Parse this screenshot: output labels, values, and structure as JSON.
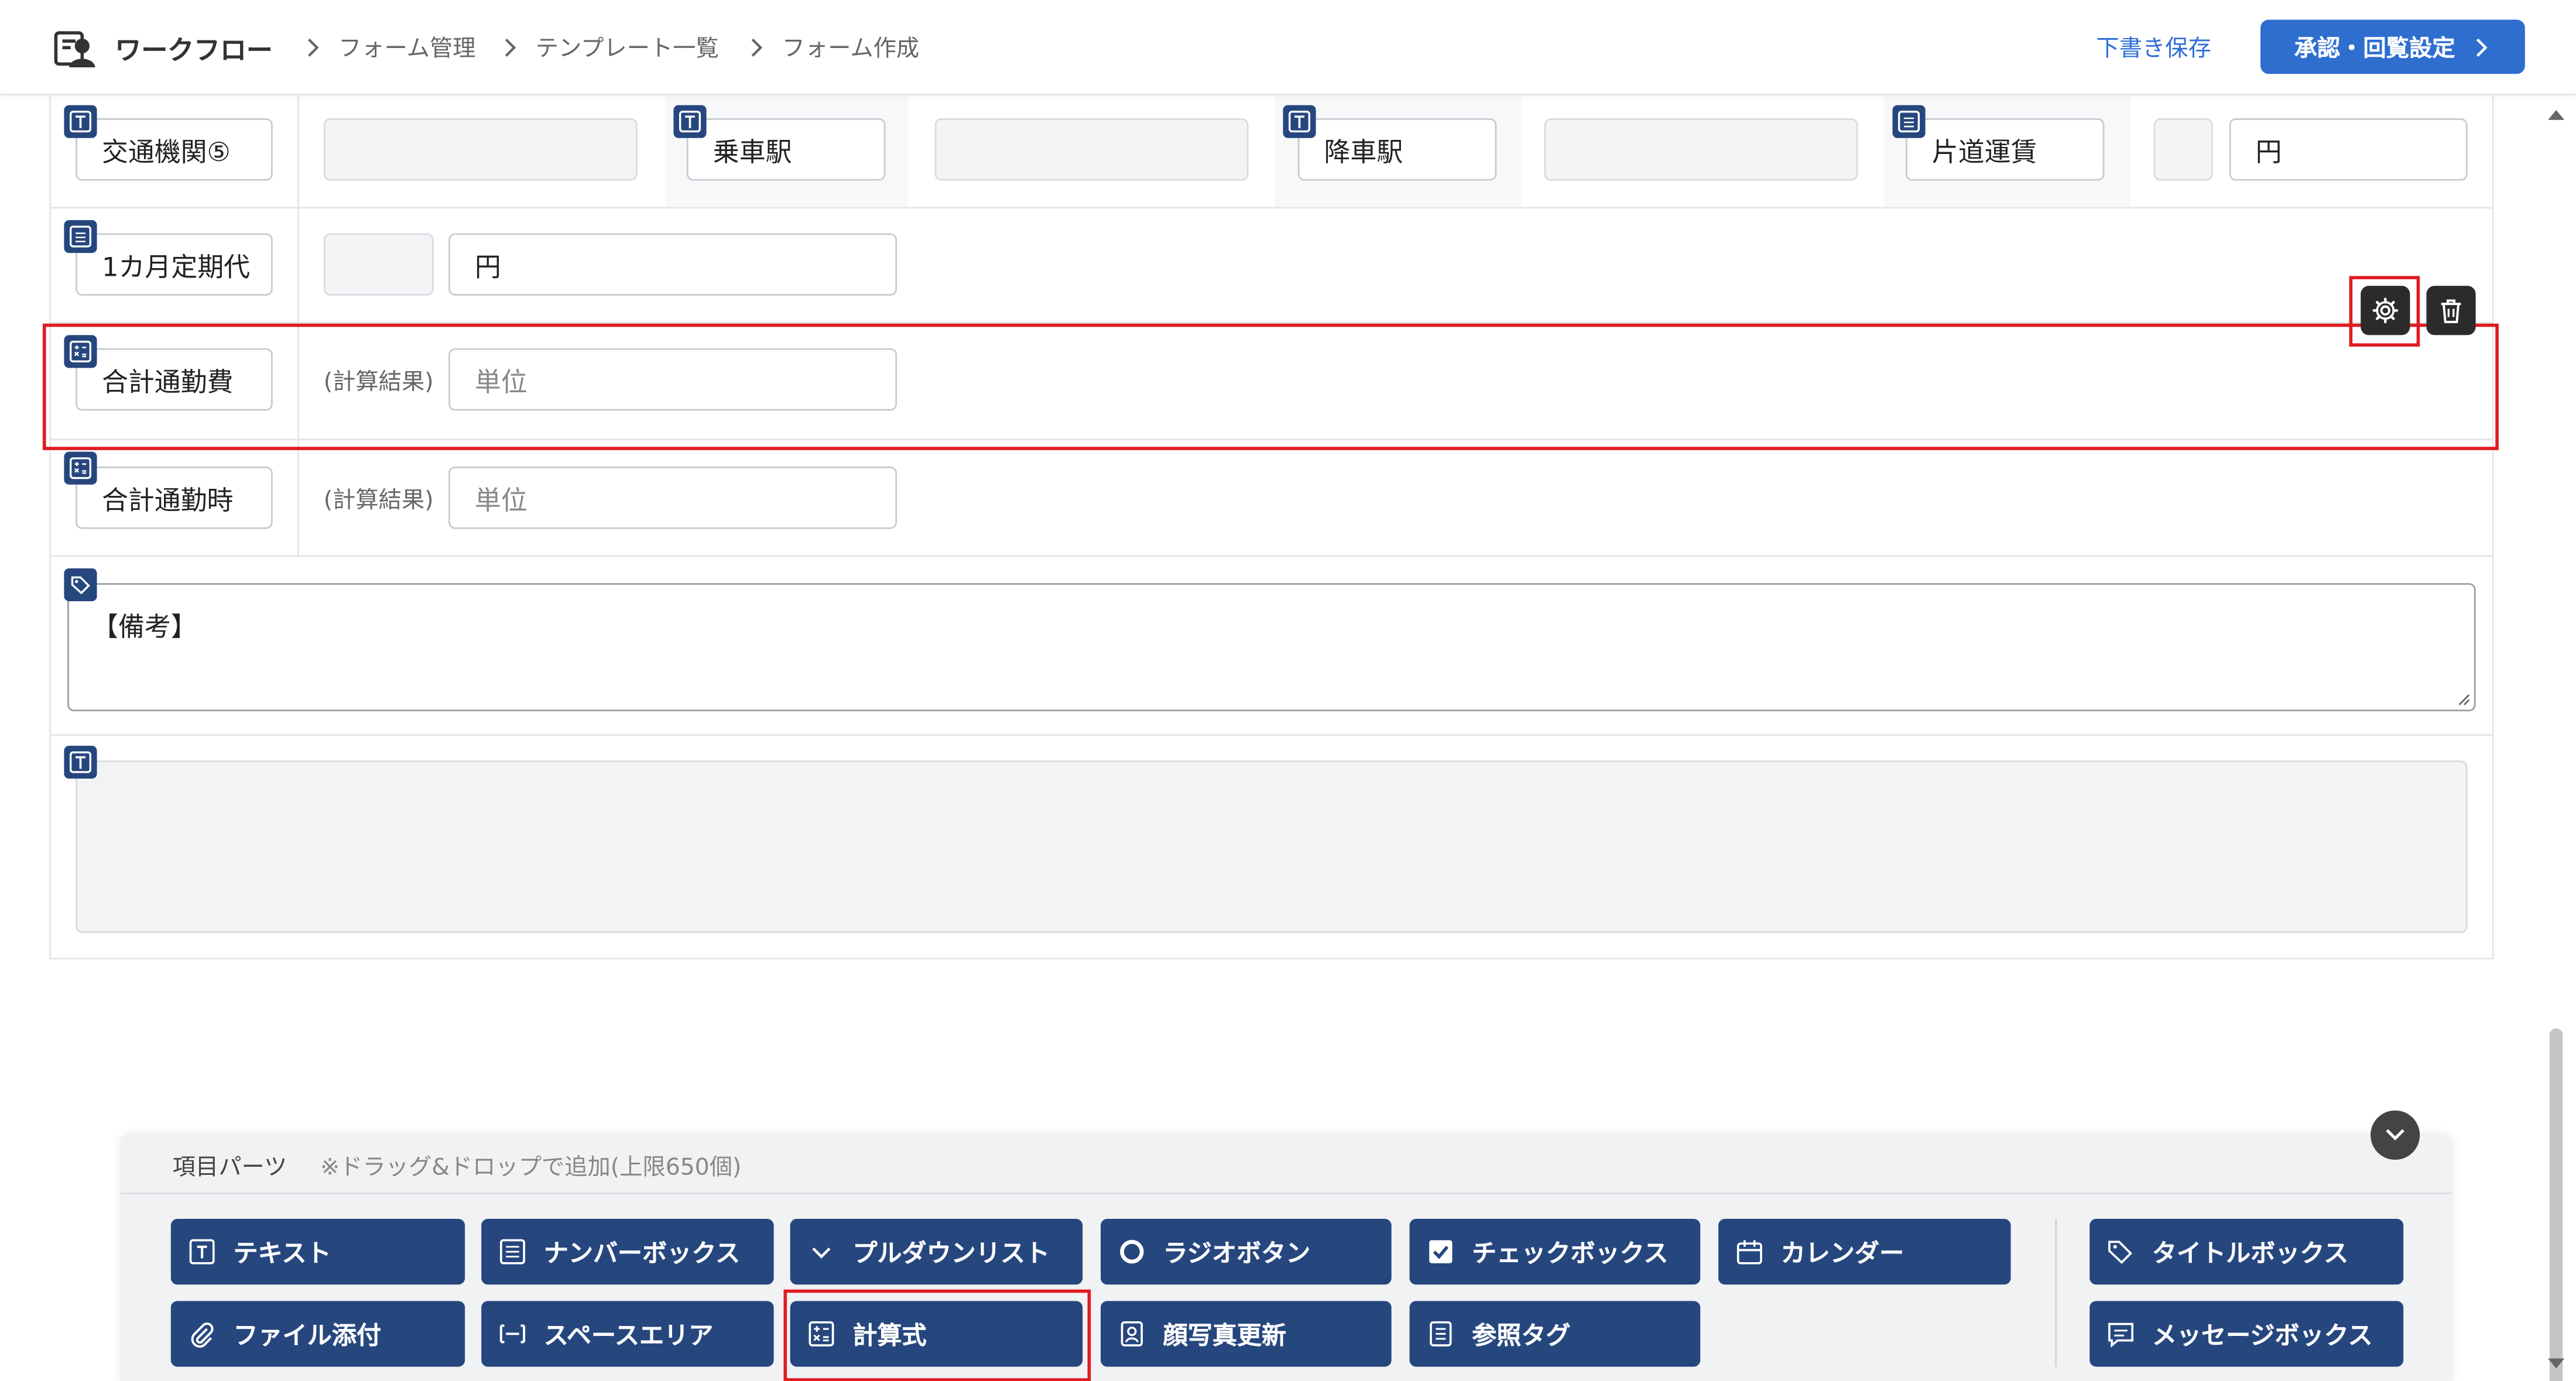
{
  "header": {
    "app_title": "ワークフロー",
    "breadcrumbs": [
      "フォーム管理",
      "テンプレート一覧",
      "フォーム作成"
    ],
    "draft_save_label": "下書き保存",
    "approval_settings_label": "承認・回覧設定"
  },
  "form": {
    "transport_row": {
      "label": "交通機関⑤",
      "boarding_label": "乗車駅",
      "alighting_label": "降車駅",
      "fare_label": "片道運賃",
      "currency_unit": "円"
    },
    "pass_row": {
      "label": "1カ月定期代",
      "currency_unit": "円"
    },
    "total_cost_row": {
      "label": "合計通勤費",
      "calc_note": "(計算結果)",
      "unit_placeholder": "単位"
    },
    "total_time_row": {
      "label": "合計通勤時",
      "calc_note": "(計算結果)",
      "unit_placeholder": "単位"
    },
    "remarks_row": {
      "text": "【備考】"
    }
  },
  "palette": {
    "title": "項目パーツ",
    "note": "※ドラッグ&ドロップで追加(上限650個)",
    "parts": [
      {
        "label": "テキスト",
        "icon": "text-icon"
      },
      {
        "label": "ナンバーボックス",
        "icon": "number-icon"
      },
      {
        "label": "プルダウンリスト",
        "icon": "chevron-down-icon"
      },
      {
        "label": "ラジオボタン",
        "icon": "radio-icon"
      },
      {
        "label": "チェックボックス",
        "icon": "checkbox-icon"
      },
      {
        "label": "カレンダー",
        "icon": "calendar-icon"
      },
      {
        "label": "タイトルボックス",
        "icon": "tag-icon"
      },
      {
        "label": "ファイル添付",
        "icon": "paperclip-icon"
      },
      {
        "label": "スペースエリア",
        "icon": "space-icon"
      },
      {
        "label": "計算式",
        "icon": "calculator-icon"
      },
      {
        "label": "顔写真更新",
        "icon": "portrait-icon"
      },
      {
        "label": "参照タグ",
        "icon": "list-icon"
      },
      {
        "label": "メッセージボックス",
        "icon": "message-icon"
      }
    ]
  },
  "colors": {
    "navy": "#26467e",
    "primary": "#2e6ecf",
    "highlight": "#e01b22"
  }
}
